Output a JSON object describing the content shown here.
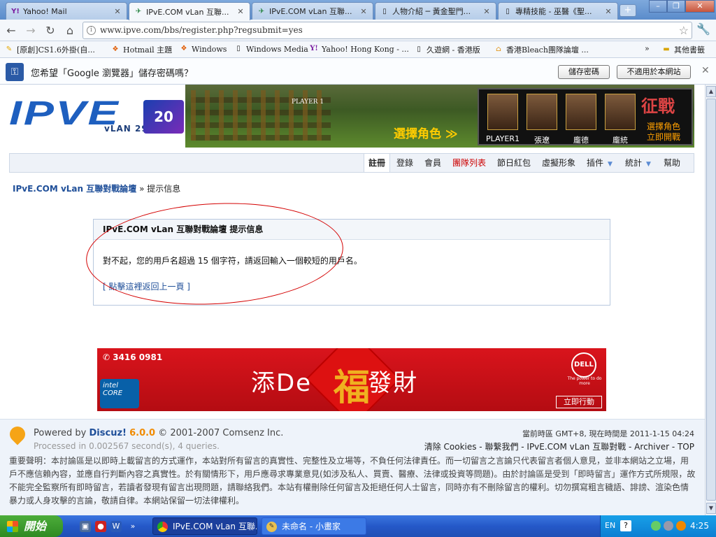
{
  "browser": {
    "tabs": [
      {
        "label": "Yahoo! Mail",
        "icon": "yahoo-icon",
        "active": false
      },
      {
        "label": "IPvE.COM vLan 互聯...",
        "icon": "ipve-icon",
        "active": true
      },
      {
        "label": "IPvE.COM vLan 互聯...",
        "icon": "ipve-icon",
        "active": false
      },
      {
        "label": "人物介紹 ─ 黃金聖門...",
        "icon": "page-icon",
        "active": false
      },
      {
        "label": "專精技能 - 巫醫《聖...",
        "icon": "page-icon",
        "active": false
      }
    ],
    "tab_close": "✕",
    "new_tab": "+",
    "window_controls": {
      "minimize": "–",
      "restore": "❐",
      "close": "✕"
    },
    "url": "www.ipve.com/bbs/register.php?regsubmit=yes",
    "bookmarks": [
      {
        "label": "[原創]CS1.6外掛(自...",
        "icon": "folder-yellow-icon"
      },
      {
        "label": "Hotmail 主題",
        "icon": "windows-flag-icon"
      },
      {
        "label": "Windows",
        "icon": "windows-flag-icon"
      },
      {
        "label": "Windows Media",
        "icon": "page-icon"
      },
      {
        "label": "Yahoo! Hong Kong - ...",
        "icon": "yahoo-icon"
      },
      {
        "label": "久遊網 - 香港版",
        "icon": "page-icon"
      },
      {
        "label": "香港Bleach團隊論壇 ...",
        "icon": "home-icon"
      }
    ],
    "bookmarks_more": "»",
    "other_bookmarks": "其他書籤",
    "infobar": {
      "message": "您希望「Google 瀏覽器」儲存密碼嗎？",
      "save_button": "儲存密碼",
      "never_button": "不適用於本網站",
      "close": "✕"
    }
  },
  "site": {
    "logo_text": "IPVE",
    "logo_sub": "vLAN 2900",
    "logo_badge": "20 11",
    "banner": {
      "player_label": "PLAYER 1",
      "choose_text": "選擇角色 ≫",
      "brand": "征戰",
      "cta_line1": "選擇角色",
      "cta_line2": "立即開戰",
      "characters": [
        "PLAYER1",
        "張遼",
        "龐德",
        "龐統"
      ]
    },
    "nav": [
      {
        "label": "註冊",
        "active": true
      },
      {
        "label": "登錄"
      },
      {
        "label": "會員"
      },
      {
        "label": "團隊列表",
        "red": true
      },
      {
        "label": "節日紅包"
      },
      {
        "label": "虛擬形象"
      },
      {
        "label": "插件",
        "dropdown": true
      },
      {
        "label": "統計",
        "dropdown": true
      },
      {
        "label": "幫助"
      }
    ],
    "nav_dropdown_glyph": "▼",
    "breadcrumb": {
      "home": "IPvE.COM vLan 互聯對戰論壇",
      "sep": " » ",
      "current": "提示信息"
    },
    "message_box": {
      "title": "IPvE.COM vLan 互聯對戰論壇 提示信息",
      "message": "對不起，您的用戶名超過 15 個字符，請返回輸入一個較短的用戶名。",
      "back_link": "[ 點擊這裡返回上一頁 ]"
    },
    "ad": {
      "phone": "3416 0981",
      "slogan_left": "添De",
      "slogan_right": "發財",
      "fu": "福",
      "intel": "intel CORE",
      "dell": "DELL",
      "dell_tagline": "The power to do more",
      "action": "立即行動",
      "colors": {
        "background": "#d9141c",
        "gold": "#f0b020"
      }
    },
    "footer": {
      "powered_by": "Powered by",
      "discuz": "Discuz!",
      "version": "6.0.0",
      "copyright": "© 2001-2007 Comsenz Inc.",
      "processed": "Processed in 0.002567 second(s), 4 queries.",
      "timezone": "當前時區 GMT+8, 現在時間是 2011-1-15 04:24",
      "links": "清除 Cookies - 聯繫我們 - IPvE.COM vLan 互聯對戰 - Archiver - TOP",
      "disclaimer": "重要聲明：本討論區是以即時上載留言的方式運作，本站對所有留言的真實性、完整性及立場等，不負任何法律責任。而一切留言之言論只代表留言者個人意見，並非本網站之立場，用戶不應信賴內容，並應自行判斷內容之真實性。於有關情形下，用戶應尋求專業意見(如涉及私人、買賣、醫療、法律或投資等問題)。由於討論區是受到「即時留言」運作方式所規限，故不能完全監察所有即時留言，若讀者發現有留言出現問題，請聯絡我們。本站有權刪除任何留言及拒絕任何人士留言，同時亦有不刪除留言的權利。切勿撰寫粗言穢語、誹謗、渲染色情暴力或人身攻擊的言論，敬請自律。本網站保留一切法律權利。"
    }
  },
  "taskbar": {
    "start": "開始",
    "tasks": [
      {
        "label": "IPvE.COM vLan 互聯...",
        "icon": "chrome-icon",
        "active": true
      },
      {
        "label": "未命名 - 小畫家",
        "icon": "paint-icon",
        "active": false
      }
    ],
    "lang": "EN",
    "help": "?",
    "clock": "4:25"
  },
  "colors": {
    "link": "#1f4f99",
    "red": "#c00000",
    "taskbar": "#2558c8",
    "tray": "#0c7ed2"
  }
}
